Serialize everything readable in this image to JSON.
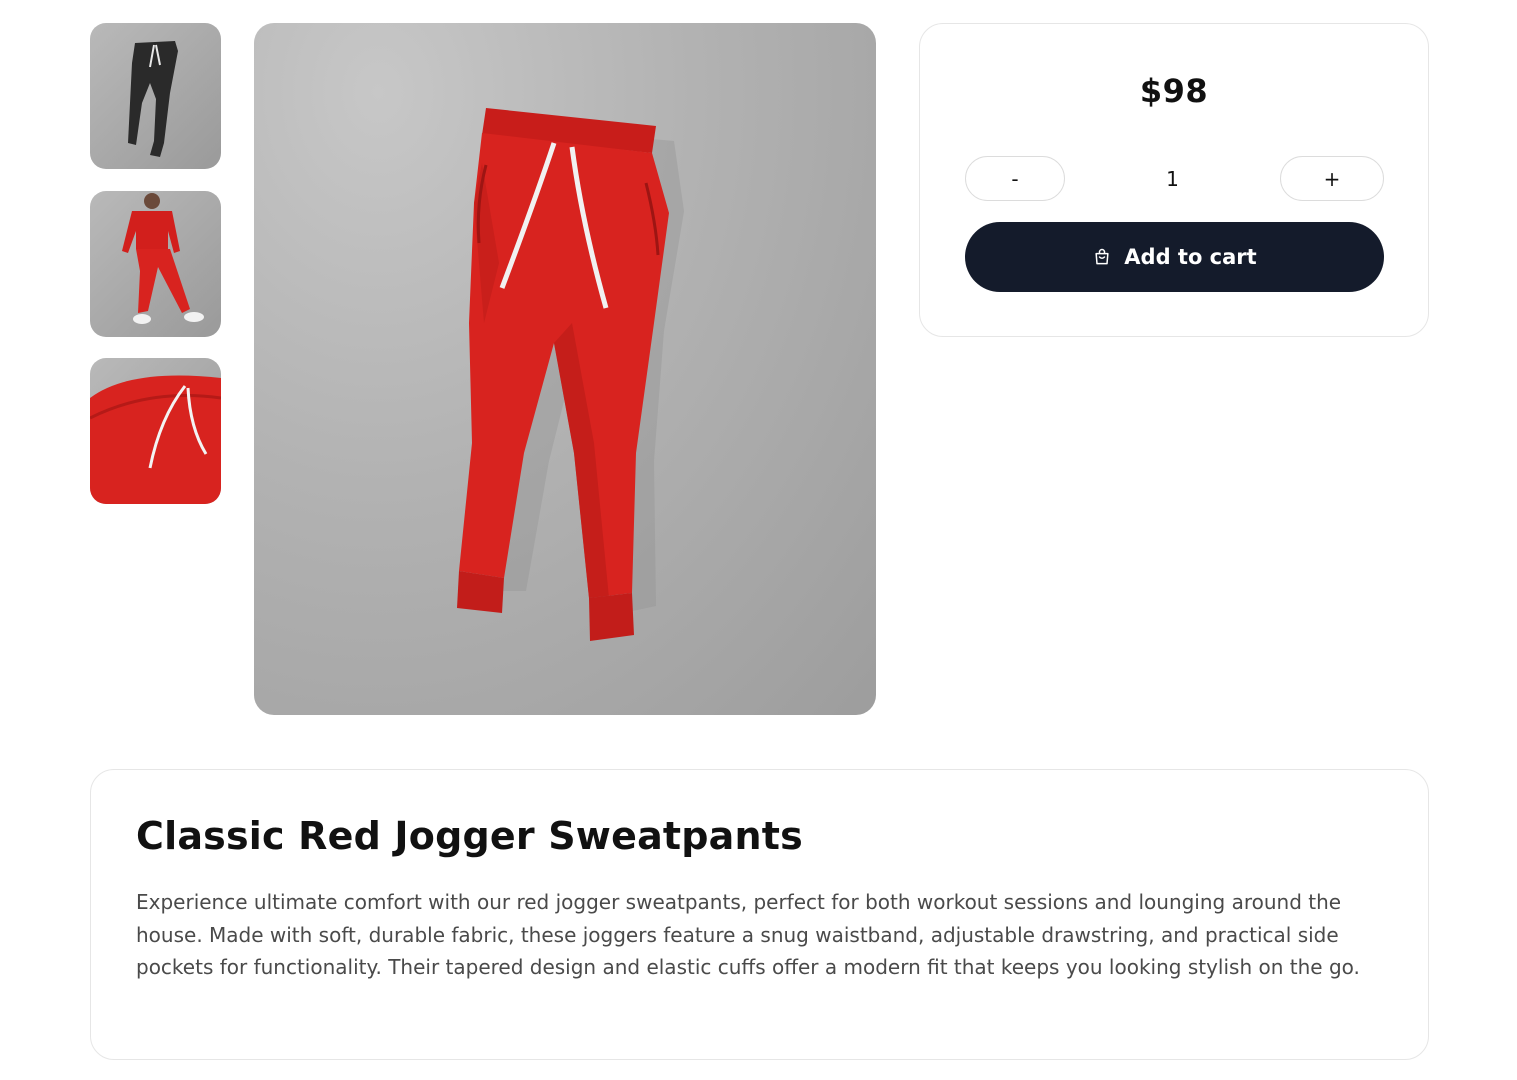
{
  "gallery": {
    "thumbnails": [
      {
        "label": "Black jogger sweatpants thumbnail",
        "icon": "pants-black-thumbnail"
      },
      {
        "label": "Model wearing red tracksuit thumbnail",
        "icon": "model-red-thumbnail"
      },
      {
        "label": "Red jogger waistband close-up thumbnail",
        "icon": "waistband-closeup-thumbnail"
      }
    ],
    "main_image_alt": "Red jogger sweatpants"
  },
  "purchase": {
    "price": "$98",
    "quantity": "1",
    "minus_label": "-",
    "plus_label": "+",
    "add_to_cart_label": "Add to cart",
    "cart_icon": "shopping-bag-icon"
  },
  "product": {
    "title": "Classic Red Jogger Sweatpants",
    "description": "Experience ultimate comfort with our red jogger sweatpants, perfect for both workout sessions and lounging around the house. Made with soft, durable fabric, these joggers feature a snug waistband, adjustable drawstring, and practical side pockets for functionality. Their tapered design and elastic cuffs offer a modern fit that keeps you looking stylish on the go."
  },
  "colors": {
    "button_dark": "#141b2b",
    "product_red": "#d8231f",
    "border": "#e6e6e6",
    "text_muted": "#4a4a4a"
  }
}
